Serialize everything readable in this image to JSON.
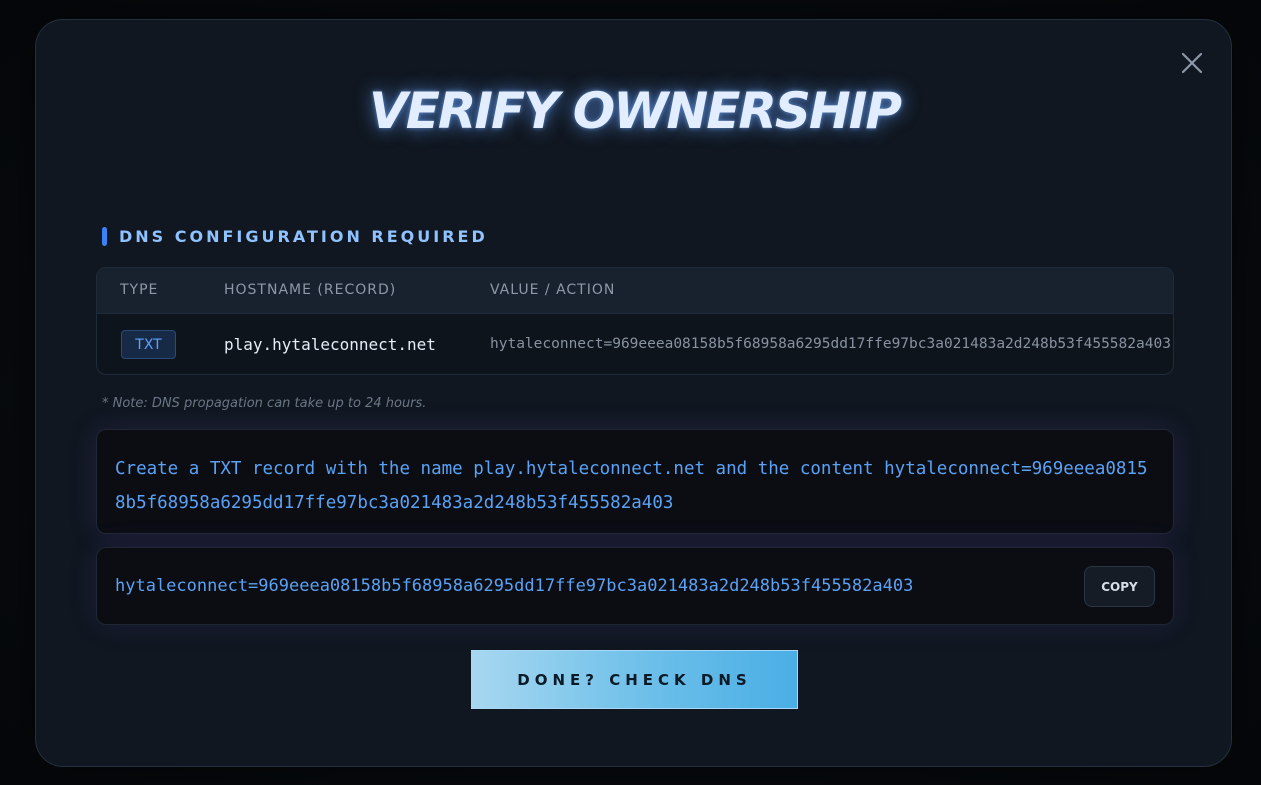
{
  "modal": {
    "title": "VERIFY OWNERSHIP",
    "close_icon": "close-icon"
  },
  "section": {
    "title": "DNS CONFIGURATION REQUIRED"
  },
  "dns_table": {
    "headers": {
      "type": "TYPE",
      "hostname": "HOSTNAME (RECORD)",
      "value": "VALUE / ACTION"
    },
    "rows": [
      {
        "type": "TXT",
        "hostname": "play.hytaleconnect.net",
        "value": "hytaleconnect=969eeea08158b5f68958a6295dd17ffe97bc3a021483a2d248b53f455582a403"
      }
    ]
  },
  "note": "* Note: DNS propagation can take up to 24 hours.",
  "instructions": "Create a TXT record with the name play.hytaleconnect.net and the content hytaleconnect=969eeea08158b5f68958a6295dd17ffe97bc3a021483a2d248b53f455582a403",
  "copy_field": {
    "value": "hytaleconnect=969eeea08158b5f68958a6295dd17ffe97bc3a021483a2d248b53f455582a403",
    "button_label": "COPY"
  },
  "done_button_label": "DONE? CHECK DNS",
  "colors": {
    "accent": "#3b82f6",
    "record_text": "#5aa2f5",
    "title_glow": "#64a0ff",
    "button_gradient_start": "#a7d7f0",
    "button_gradient_end": "#4aaee5"
  }
}
